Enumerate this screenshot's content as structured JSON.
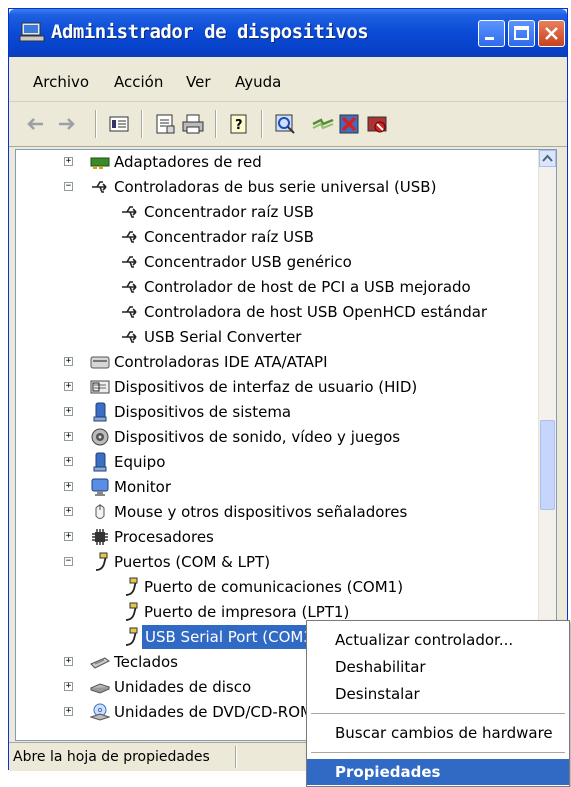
{
  "window": {
    "title": "Administrador de dispositivos"
  },
  "menubar": [
    "Archivo",
    "Acción",
    "Ver",
    "Ayuda"
  ],
  "tree": {
    "adapters": "Adaptadores de red",
    "usb_group": "Controladoras de bus serie universal (USB)",
    "usb_items": [
      "Concentrador raíz USB",
      "Concentrador raíz USB",
      "Concentrador USB genérico",
      "Controlador de host de PCI a USB mejorado",
      "Controladora de host USB OpenHCD estándar",
      "USB Serial Converter"
    ],
    "ide": "Controladoras IDE ATA/ATAPI",
    "hid": "Dispositivos de interfaz de usuario (HID)",
    "system": "Dispositivos de sistema",
    "sound": "Dispositivos de sonido, vídeo y juegos",
    "computer": "Equipo",
    "monitor": "Monitor",
    "mouse": "Mouse y otros dispositivos señaladores",
    "cpu": "Procesadores",
    "ports": "Puertos (COM & LPT)",
    "port_items": [
      "Puerto de comunicaciones (COM1)",
      "Puerto de impresora (LPT1)",
      "USB Serial Port (COM3)"
    ],
    "keyboards": "Teclados",
    "disks": "Unidades de disco",
    "dvd": "Unidades de DVD/CD-ROM"
  },
  "status": {
    "text": "Abre la hoja de propiedades"
  },
  "context_menu": {
    "update": "Actualizar controlador...",
    "disable": "Deshabilitar",
    "uninstall": "Desinstalar",
    "scan": "Buscar cambios de hardware",
    "properties": "Propiedades"
  },
  "colors": {
    "titlebar": "#0a4bd6",
    "selection": "#316ac5",
    "chrome": "#ece9d8"
  }
}
